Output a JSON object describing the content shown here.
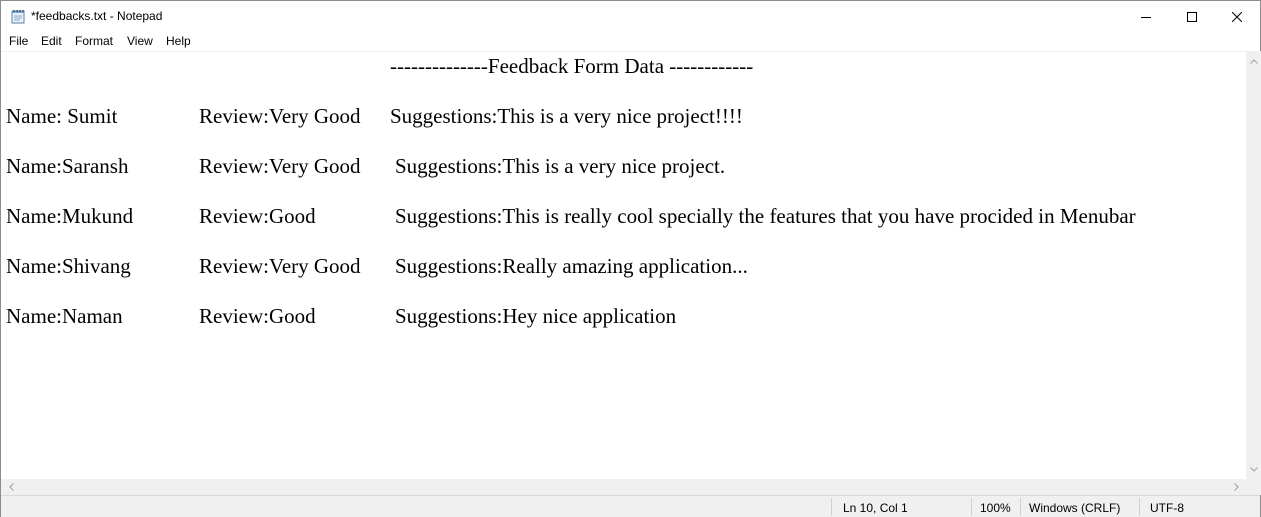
{
  "window": {
    "title": "*feedbacks.txt - Notepad",
    "icon": "notepad-icon",
    "controls": [
      "minimize-icon",
      "maximize-icon",
      "close-icon"
    ]
  },
  "menu": {
    "items": [
      {
        "label": "File"
      },
      {
        "label": "Edit"
      },
      {
        "label": "Format"
      },
      {
        "label": "View"
      },
      {
        "label": "Help"
      }
    ]
  },
  "document": {
    "heading": "--------------Feedback Form Data ------------",
    "rows": [
      {
        "name": "Name: Sumit",
        "review": "Review:Very Good",
        "suggestion": "Suggestions:This is a very nice project!!!!"
      },
      {
        "name": "Name:Saransh",
        "review": "Review:Very Good",
        "suggestion": "Suggestions:This is a very nice project."
      },
      {
        "name": "Name:Mukund",
        "review": "Review:Good",
        "suggestion": "Suggestions:This is really cool specially the features that you have procided in Menubar"
      },
      {
        "name": "Name:Shivang",
        "review": "Review:Very Good",
        "suggestion": "Suggestions:Really amazing application..."
      },
      {
        "name": "Name:Naman",
        "review": "Review:Good",
        "suggestion": "Suggestions:Hey nice application"
      }
    ]
  },
  "status": {
    "position": "Ln 10, Col 1",
    "zoom": "100%",
    "line_ending": "Windows (CRLF)",
    "encoding": "UTF-8"
  }
}
